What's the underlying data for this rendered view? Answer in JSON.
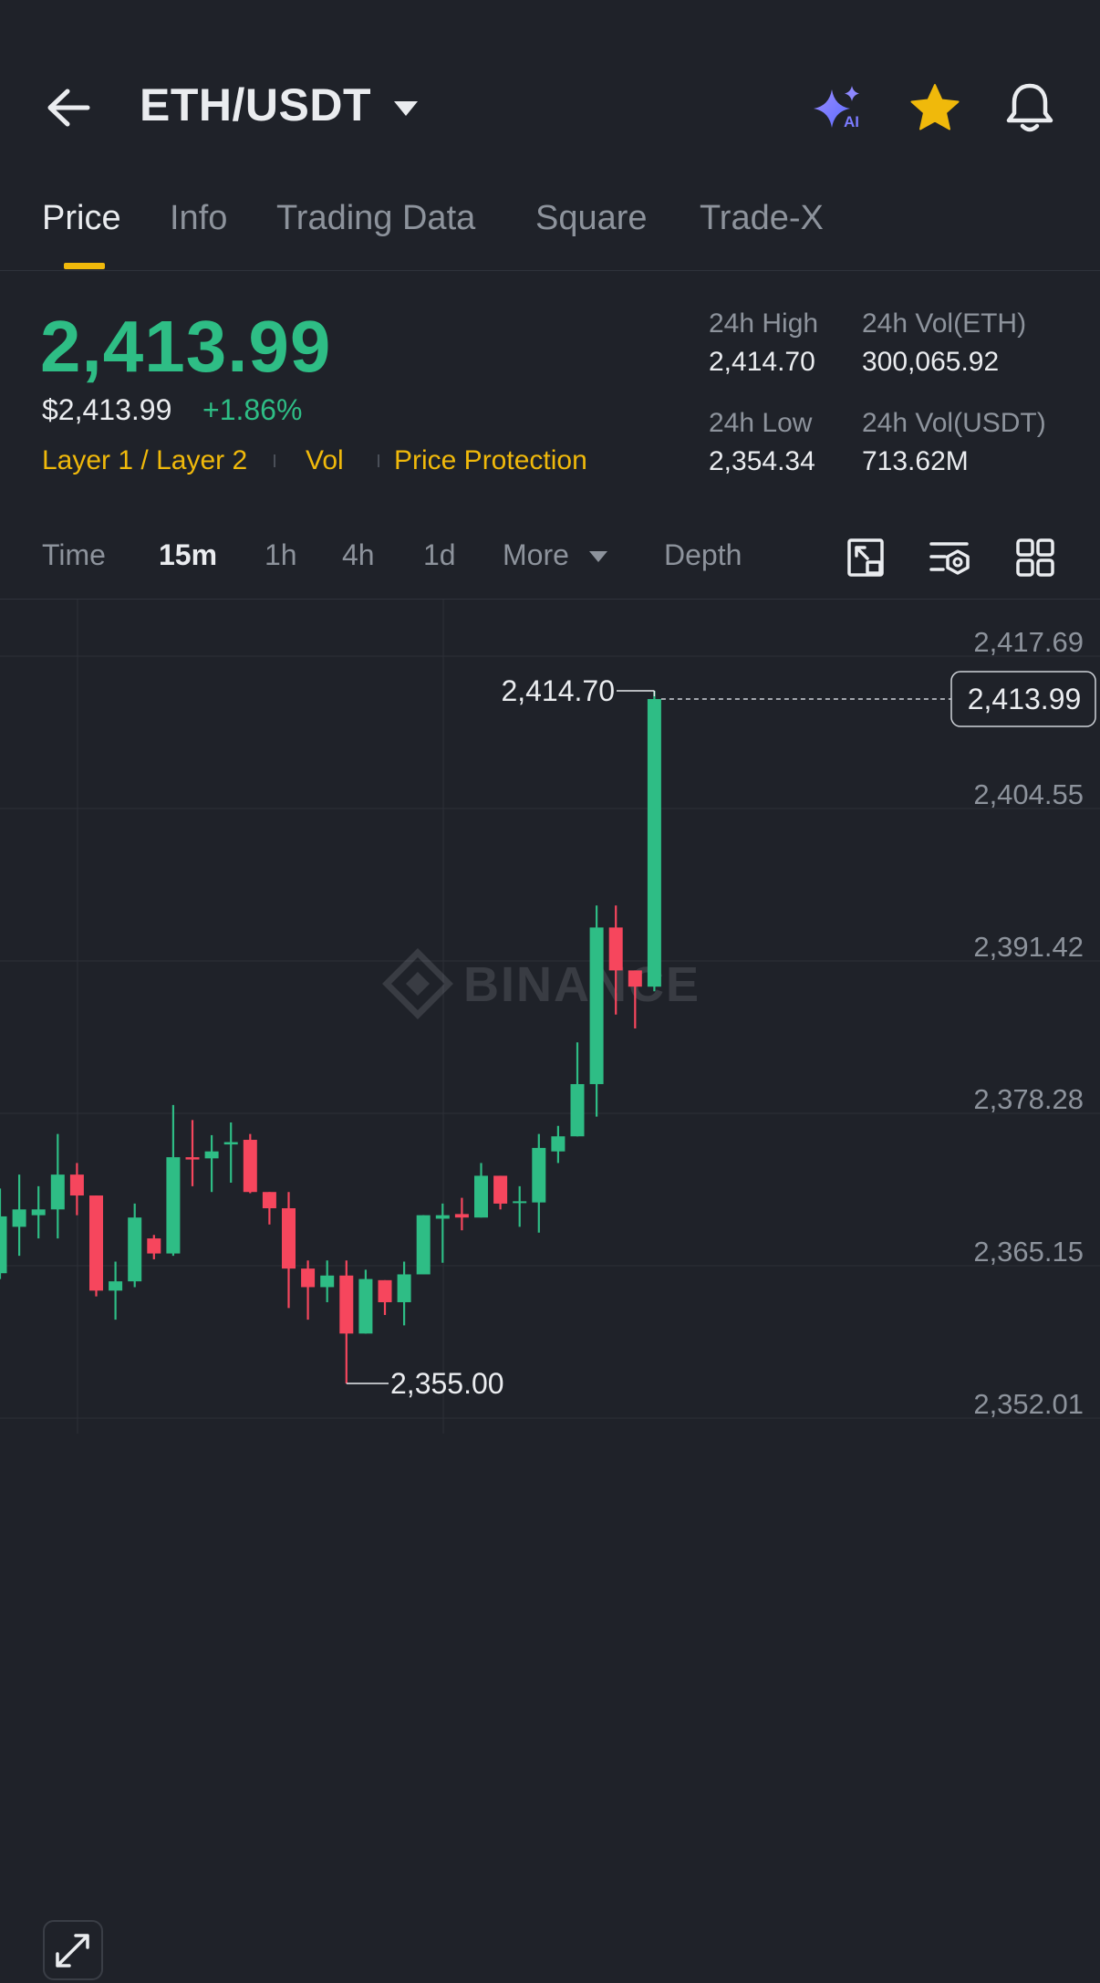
{
  "header": {
    "pair": "ETH/USDT",
    "icons": {
      "back": "back-arrow-icon",
      "caret": "caret-down-icon",
      "ai": "ai-sparkle-icon",
      "star": "star-icon",
      "bell": "bell-icon"
    },
    "ai_badge": "AI"
  },
  "tabs": [
    {
      "label": "Price",
      "active": true
    },
    {
      "label": "Info"
    },
    {
      "label": "Trading Data"
    },
    {
      "label": "Square"
    },
    {
      "label": "Trade-X"
    }
  ],
  "ticker": {
    "last_price": "2,413.99",
    "usd_price": "$2,413.99",
    "change": "+1.86%",
    "tags": [
      "Layer 1 / Layer 2",
      "Vol",
      "Price Protection"
    ],
    "stats": {
      "high_label": "24h High",
      "high_value": "2,414.70",
      "low_label": "24h Low",
      "low_value": "2,354.34",
      "vol_eth_label": "24h Vol(ETH)",
      "vol_eth_value": "300,065.92",
      "vol_usdt_label": "24h Vol(USDT)",
      "vol_usdt_value": "713.62M"
    }
  },
  "timeframes": [
    "Time",
    "15m",
    "1h",
    "4h",
    "1d",
    "More",
    "Depth"
  ],
  "active_timeframe": "15m",
  "colors": {
    "up": "#2ebd85",
    "down": "#f6465d",
    "accent": "#f0b90b",
    "bg": "#1f2229"
  },
  "chart": {
    "watermark": "BINANCE",
    "current_price_label": "2,413.99",
    "high_marker": "2,414.70",
    "low_marker": "2,355.00"
  },
  "chart_data": {
    "type": "candlestick",
    "ytick_labels": [
      "2,417.69",
      "2,404.55",
      "2,391.42",
      "2,378.28",
      "2,365.15",
      "2,352.01"
    ],
    "ylim": [
      2352.01,
      2417.69
    ],
    "current_price": 2413.99,
    "high_marker": 2414.7,
    "low_marker": 2355.0,
    "candles": [
      [
        2364.5,
        2369.4,
        2364.0,
        2371.8
      ],
      [
        2368.5,
        2370.0,
        2366.0,
        2373.0
      ],
      [
        2369.5,
        2370.0,
        2367.5,
        2372.0
      ],
      [
        2370.0,
        2373.0,
        2367.5,
        2376.5
      ],
      [
        2373.0,
        2371.2,
        2369.5,
        2374.0
      ],
      [
        2371.2,
        2363.0,
        2362.5,
        2371.2
      ],
      [
        2363.0,
        2363.8,
        2360.5,
        2365.5
      ],
      [
        2363.8,
        2369.3,
        2363.3,
        2370.5
      ],
      [
        2367.5,
        2366.2,
        2365.7,
        2367.8
      ],
      [
        2366.2,
        2374.5,
        2366.0,
        2379.0
      ],
      [
        2374.5,
        2374.3,
        2372.0,
        2377.7
      ],
      [
        2374.4,
        2375.0,
        2371.5,
        2376.4
      ],
      [
        2375.6,
        2375.8,
        2372.3,
        2377.5
      ],
      [
        2376.0,
        2371.5,
        2371.4,
        2376.5
      ],
      [
        2371.5,
        2370.1,
        2368.7,
        2371.5
      ],
      [
        2370.1,
        2364.9,
        2361.5,
        2371.5
      ],
      [
        2364.9,
        2363.3,
        2360.5,
        2365.6
      ],
      [
        2363.3,
        2364.3,
        2362.0,
        2365.6
      ],
      [
        2364.3,
        2359.3,
        2355.0,
        2365.6
      ],
      [
        2359.3,
        2364.0,
        2359.3,
        2364.8
      ],
      [
        2363.9,
        2362.0,
        2360.9,
        2363.9
      ],
      [
        2362.0,
        2364.4,
        2360.0,
        2365.5
      ],
      [
        2364.4,
        2369.5,
        2364.4,
        2369.5
      ],
      [
        2369.2,
        2369.5,
        2365.4,
        2370.5
      ],
      [
        2369.6,
        2369.3,
        2368.2,
        2371.0
      ],
      [
        2369.3,
        2372.9,
        2369.3,
        2374.0
      ],
      [
        2372.9,
        2370.5,
        2370.0,
        2372.9
      ],
      [
        2370.6,
        2370.7,
        2368.5,
        2372.0
      ],
      [
        2370.6,
        2375.3,
        2368.0,
        2376.5
      ],
      [
        2375.0,
        2376.3,
        2374.0,
        2377.2
      ],
      [
        2376.3,
        2380.8,
        2376.3,
        2384.4
      ],
      [
        2380.8,
        2394.3,
        2378.0,
        2396.2
      ],
      [
        2394.3,
        2390.6,
        2386.8,
        2396.2
      ],
      [
        2390.6,
        2389.2,
        2385.6,
        2390.6
      ],
      [
        2389.2,
        2413.99,
        2388.8,
        2414.7
      ]
    ]
  }
}
